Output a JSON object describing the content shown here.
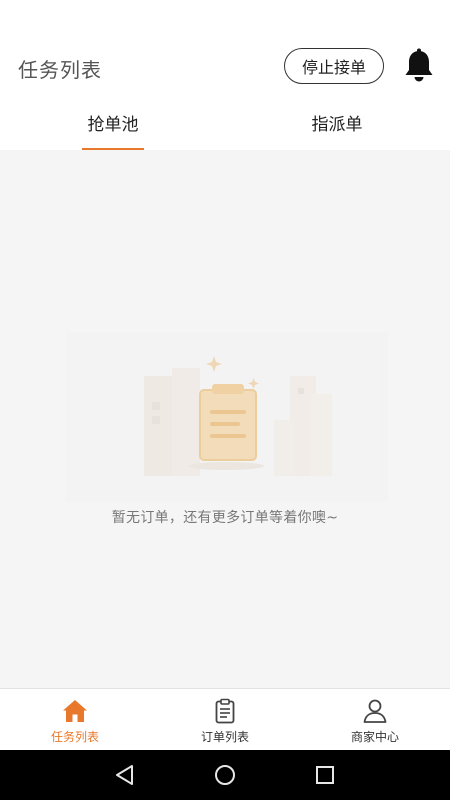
{
  "header": {
    "title": "任务列表",
    "stop_button_label": "停止接单",
    "bell_icon": "bell-icon"
  },
  "tabs": [
    {
      "label": "抢单池",
      "active": true
    },
    {
      "label": "指派单",
      "active": false
    }
  ],
  "empty_state": {
    "message": "暂无订单，还有更多订单等着你噢~",
    "illustration_icon": "clipboard-illustration"
  },
  "bottom_nav": [
    {
      "label": "任务列表",
      "icon": "home-icon",
      "active": true
    },
    {
      "label": "订单列表",
      "icon": "clipboard-icon",
      "active": false
    },
    {
      "label": "商家中心",
      "icon": "user-icon",
      "active": false
    }
  ],
  "system_nav": {
    "back_icon": "back-triangle-icon",
    "home_icon": "home-circle-icon",
    "recent_icon": "recent-square-icon"
  },
  "colors": {
    "accent": "#e8792c",
    "content_bg": "#f5f5f6",
    "text_dark": "#222222",
    "text_muted": "#777777"
  }
}
